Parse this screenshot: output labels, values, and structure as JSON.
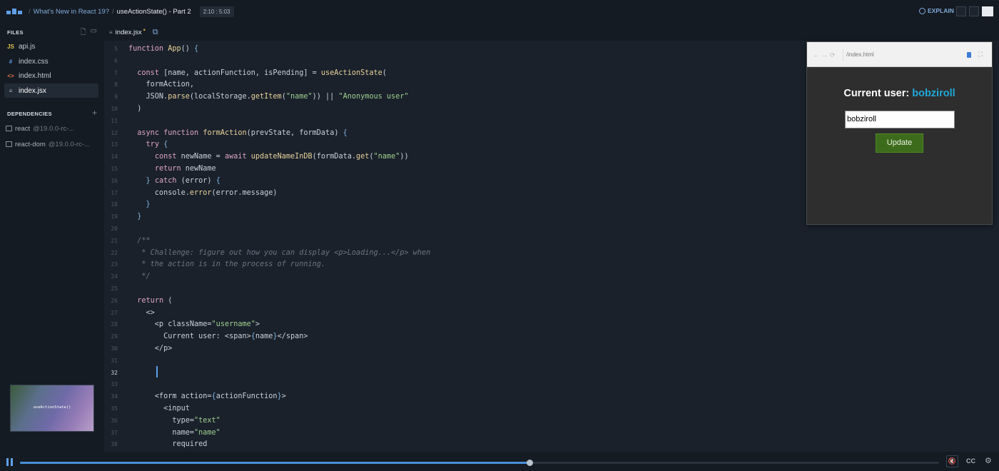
{
  "header": {
    "breadcrumb_course": "What's New in React 19?",
    "breadcrumb_lesson": "useActionState() - Part 2",
    "time": "2:10 : 5:03",
    "explain_label": "EXPLAIN"
  },
  "sidebar": {
    "files_heading": "FILES",
    "files": [
      {
        "icon": "JS",
        "name": "api.js"
      },
      {
        "icon": "#",
        "name": "index.css"
      },
      {
        "icon": "<>",
        "name": "index.html"
      },
      {
        "icon": "≡",
        "name": "index.jsx"
      }
    ],
    "dependencies_heading": "DEPENDENCIES",
    "dependencies": [
      {
        "name": "react",
        "version": "@19.0.0-rc-..."
      },
      {
        "name": "react-dom",
        "version": "@19.0.0-rc-..."
      }
    ],
    "thumbnail_text": "useActionState()"
  },
  "editor": {
    "tab_label": "index.jsx",
    "line_numbers": [
      "5",
      "6",
      "7",
      "8",
      "9",
      "10",
      "11",
      "12",
      "13",
      "14",
      "15",
      "16",
      "17",
      "18",
      "19",
      "20",
      "21",
      "22",
      "23",
      "24",
      "25",
      "26",
      "27",
      "28",
      "29",
      "30",
      "31",
      "32",
      "33",
      "34",
      "35",
      "36",
      "37",
      "38"
    ],
    "lines": [
      "function App() {",
      "",
      "  const [name, actionFunction, isPending] = useActionState(",
      "    formAction,",
      "    JSON.parse(localStorage.getItem(\"name\")) || \"Anonymous user\"",
      "  )",
      "",
      "  async function formAction(prevState, formData) {",
      "    try {",
      "      const newName = await updateNameInDB(formData.get(\"name\"))",
      "      return newName",
      "    } catch (error) {",
      "      console.error(error.message)",
      "    }",
      "  }",
      "",
      "  /**",
      "   * Challenge: figure out how you can display <p>Loading...</p> when",
      "   * the action is in the process of running.",
      "   */",
      "",
      "  return (",
      "    <>",
      "      <p className=\"username\">",
      "        Current user: <span>{name}</span>",
      "      </p>",
      "",
      "",
      "",
      "      <form action={actionFunction}>",
      "        <input",
      "          type=\"text\"",
      "          name=\"name\"",
      "          required"
    ]
  },
  "preview": {
    "url": "/index.html",
    "heading_label": "Current user: ",
    "heading_name": "bobziroll",
    "input_value": "bobziroll",
    "button_label": "Update",
    "name_color": "#1fa8d8",
    "button_color": "#3d6b1c"
  },
  "player": {
    "progress": 0.43,
    "cc_label": "CC"
  }
}
